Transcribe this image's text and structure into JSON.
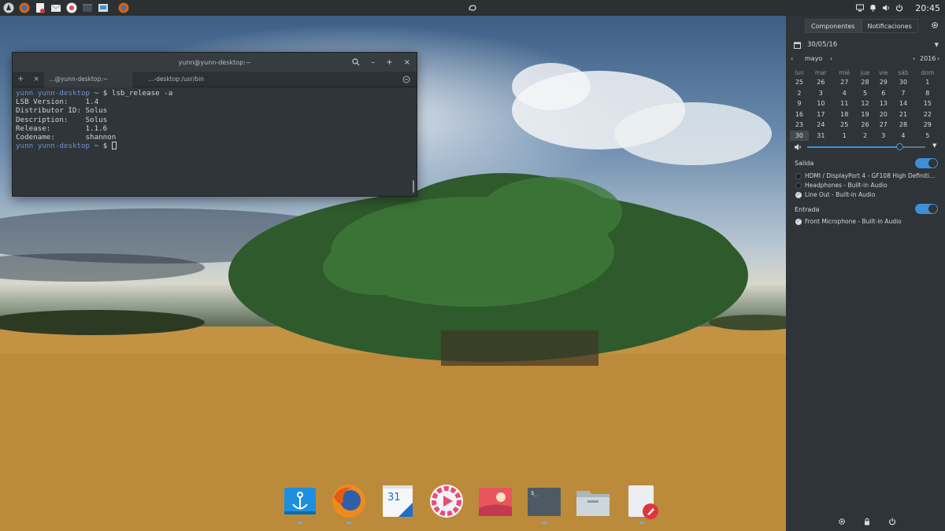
{
  "topbar": {
    "clock": "20:45",
    "launcher_icons": [
      "solus-menu-icon",
      "firefox-icon",
      "text-editor-icon",
      "mail-icon",
      "software-center-icon",
      "terminal-icon",
      "system-monitor-icon",
      "firefox-icon"
    ],
    "tray_icons": [
      "display-icon",
      "bell-icon",
      "volume-icon",
      "power-icon"
    ]
  },
  "terminal": {
    "title": "yunn@yunn-desktop:~",
    "tabs": [
      "…@yunn-desktop:~",
      "…-desktop:/usr/bin"
    ],
    "lines": [
      {
        "user": "yunn",
        "host": "yunn-desktop",
        "dir": "~",
        "cmd": "lsb_release -a"
      },
      {
        "text": "LSB Version:    1.4"
      },
      {
        "text": "Distributor ID: Solus"
      },
      {
        "text": "Description:    Solus"
      },
      {
        "text": "Release:        1.1.6"
      },
      {
        "text": "Codename:       shannon"
      },
      {
        "user": "yunn",
        "host": "yunn-desktop",
        "dir": "~",
        "cmd": ""
      }
    ]
  },
  "panel": {
    "tabs": [
      "Componentes",
      "Notificaciones"
    ],
    "date": "30/05/16",
    "month": "mayo",
    "year": "2016",
    "weekdays": [
      "lun",
      "mar",
      "mié",
      "jue",
      "vie",
      "sáb",
      "dom"
    ],
    "weeks": [
      [
        "25",
        "26",
        "27",
        "28",
        "29",
        "30",
        "1"
      ],
      [
        "2",
        "3",
        "4",
        "5",
        "6",
        "7",
        "8"
      ],
      [
        "9",
        "10",
        "11",
        "12",
        "13",
        "14",
        "15"
      ],
      [
        "16",
        "17",
        "18",
        "19",
        "20",
        "21",
        "22"
      ],
      [
        "23",
        "24",
        "25",
        "26",
        "27",
        "28",
        "29"
      ],
      [
        "30",
        "31",
        "1",
        "2",
        "3",
        "4",
        "5"
      ]
    ],
    "today": "30",
    "volume_level": 0.78,
    "output_label": "Salida",
    "output_devices": [
      {
        "name": "HDMI / DisplayPort 4 - GF108 High Definiti…",
        "selected": false
      },
      {
        "name": "Headphones - Built-in Audio",
        "selected": false
      },
      {
        "name": "Line Out - Built-in Audio",
        "selected": true
      }
    ],
    "input_label": "Entrada",
    "input_devices": [
      {
        "name": "Front Microphone - Built-in Audio",
        "selected": true
      }
    ],
    "bottom_icons": [
      "settings-icon",
      "lock-icon",
      "power-icon"
    ]
  },
  "dock": {
    "items": [
      "anchor-icon",
      "firefox-icon",
      "calendar-icon",
      "media-player-icon",
      "image-viewer-icon",
      "terminal-icon",
      "file-manager-icon",
      "text-editor-icon"
    ],
    "calendar_day": "31"
  },
  "colors": {
    "accent": "#3d8fd6",
    "panel_bg": "#2e3437",
    "topbar_bg": "#2b3033"
  }
}
